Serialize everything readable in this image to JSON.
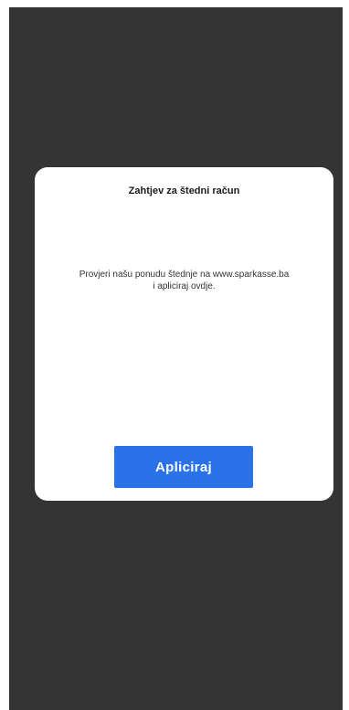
{
  "dialog": {
    "title": "Zahtjev za štedni račun",
    "message_line1": "Provjeri našu ponudu štednje na www.sparkasse.ba",
    "message_line2": "i apliciraj ovdje.",
    "button_label": "Apliciraj"
  },
  "colors": {
    "backdrop": "#343434",
    "dialog_background": "#ffffff",
    "button_background": "#2a72e8",
    "button_text": "#ffffff"
  }
}
